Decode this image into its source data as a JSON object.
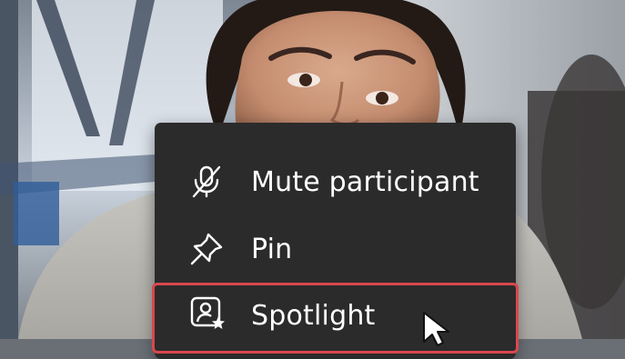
{
  "context_menu": {
    "items": [
      {
        "label": "Mute participant",
        "icon": "mic-off-icon"
      },
      {
        "label": "Pin",
        "icon": "pin-icon"
      },
      {
        "label": "Spotlight",
        "icon": "spotlight-icon",
        "highlighted": true
      }
    ]
  },
  "colors": {
    "menu_background": "#2b2b2b",
    "menu_text": "#ffffff",
    "highlight_border": "#d9474d"
  }
}
